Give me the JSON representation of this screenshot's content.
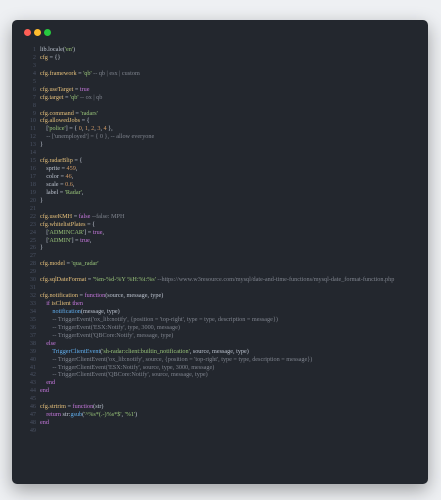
{
  "window": {
    "controls": [
      {
        "name": "close",
        "color": "#ff5f56"
      },
      {
        "name": "minimize",
        "color": "#ffbd2e"
      },
      {
        "name": "maximize",
        "color": "#27c93f"
      }
    ]
  },
  "colors": {
    "plain": "#bcc3cf",
    "keyword": "#c678dd",
    "function": "#61afef",
    "identifier": "#e6c07b",
    "string": "#98c379",
    "number": "#d19a66",
    "comment": "#7f848e"
  },
  "code_lines": [
    {
      "n": "1",
      "tokens": [
        [
          "lib.locale(",
          "plain"
        ],
        [
          "'en'",
          "str"
        ],
        [
          ")",
          "plain"
        ]
      ]
    },
    {
      "n": "2",
      "tokens": [
        [
          "cfg",
          "id"
        ],
        [
          " = {}",
          "plain"
        ]
      ]
    },
    {
      "n": "3",
      "tokens": []
    },
    {
      "n": "4",
      "tokens": [
        [
          "cfg.framework",
          "id"
        ],
        [
          " = ",
          "plain"
        ],
        [
          "'qb'",
          "str"
        ],
        [
          " -- qb | esx | custom",
          "cm"
        ]
      ]
    },
    {
      "n": "5",
      "tokens": []
    },
    {
      "n": "6",
      "tokens": [
        [
          "cfg.useTarget",
          "id"
        ],
        [
          " = ",
          "plain"
        ],
        [
          "true",
          "kw"
        ]
      ]
    },
    {
      "n": "7",
      "tokens": [
        [
          "cfg.target",
          "id"
        ],
        [
          " = ",
          "plain"
        ],
        [
          "'qb'",
          "str"
        ],
        [
          " -- ox | qb",
          "cm"
        ]
      ]
    },
    {
      "n": "8",
      "tokens": []
    },
    {
      "n": "9",
      "tokens": [
        [
          "cfg.command",
          "id"
        ],
        [
          " = ",
          "plain"
        ],
        [
          "'radars'",
          "str"
        ]
      ]
    },
    {
      "n": "10",
      "tokens": [
        [
          "cfg.allowedJobs",
          "id"
        ],
        [
          " = {",
          "plain"
        ]
      ]
    },
    {
      "n": "11",
      "tokens": [
        [
          "    [",
          "plain"
        ],
        [
          "'police'",
          "str"
        ],
        [
          "] = { ",
          "plain"
        ],
        [
          "0",
          "num"
        ],
        [
          ", ",
          "plain"
        ],
        [
          "1",
          "num"
        ],
        [
          ", ",
          "plain"
        ],
        [
          "2",
          "num"
        ],
        [
          ", ",
          "plain"
        ],
        [
          "3",
          "num"
        ],
        [
          ", ",
          "plain"
        ],
        [
          "4",
          "num"
        ],
        [
          " },",
          "plain"
        ]
      ]
    },
    {
      "n": "12",
      "tokens": [
        [
          "    -- ['unemployed'] = { 0 }, -- allow everyone",
          "cm"
        ]
      ]
    },
    {
      "n": "13",
      "tokens": [
        [
          "}",
          "plain"
        ]
      ]
    },
    {
      "n": "14",
      "tokens": []
    },
    {
      "n": "15",
      "tokens": [
        [
          "cfg.radarBlip",
          "id"
        ],
        [
          " = {",
          "plain"
        ]
      ]
    },
    {
      "n": "16",
      "tokens": [
        [
          "    sprite = ",
          "plain"
        ],
        [
          "459",
          "num"
        ],
        [
          ",",
          "plain"
        ]
      ]
    },
    {
      "n": "17",
      "tokens": [
        [
          "    color = ",
          "plain"
        ],
        [
          "46",
          "num"
        ],
        [
          ",",
          "plain"
        ]
      ]
    },
    {
      "n": "18",
      "tokens": [
        [
          "    scale = ",
          "plain"
        ],
        [
          "0.6",
          "num"
        ],
        [
          ",",
          "plain"
        ]
      ]
    },
    {
      "n": "19",
      "tokens": [
        [
          "    label = ",
          "plain"
        ],
        [
          "'Radar'",
          "str"
        ],
        [
          ",",
          "plain"
        ]
      ]
    },
    {
      "n": "20",
      "tokens": [
        [
          "}",
          "plain"
        ]
      ]
    },
    {
      "n": "21",
      "tokens": []
    },
    {
      "n": "22",
      "tokens": [
        [
          "cfg.useKMH",
          "id"
        ],
        [
          " = ",
          "plain"
        ],
        [
          "false",
          "kw"
        ],
        [
          " --false: MPH",
          "cm"
        ]
      ]
    },
    {
      "n": "23",
      "tokens": [
        [
          "cfg.whitelistPlates",
          "id"
        ],
        [
          " = {",
          "plain"
        ]
      ]
    },
    {
      "n": "24",
      "tokens": [
        [
          "    [",
          "plain"
        ],
        [
          "'ADMINCAR'",
          "str"
        ],
        [
          "] = ",
          "plain"
        ],
        [
          "true",
          "kw"
        ],
        [
          ",",
          "plain"
        ]
      ]
    },
    {
      "n": "25",
      "tokens": [
        [
          "    [",
          "plain"
        ],
        [
          "'ADMIN'",
          "str"
        ],
        [
          "] = ",
          "plain"
        ],
        [
          "true",
          "kw"
        ],
        [
          ",",
          "plain"
        ]
      ]
    },
    {
      "n": "26",
      "tokens": [
        [
          "}",
          "plain"
        ]
      ]
    },
    {
      "n": "27",
      "tokens": []
    },
    {
      "n": "28",
      "tokens": [
        [
          "cfg.model",
          "id"
        ],
        [
          " = ",
          "plain"
        ],
        [
          "'qua_radar'",
          "str"
        ]
      ]
    },
    {
      "n": "29",
      "tokens": []
    },
    {
      "n": "30",
      "tokens": [
        [
          "cfg.sqlDateFormat",
          "id"
        ],
        [
          " = ",
          "plain"
        ],
        [
          "'%m-%d-%Y %H:%i:%s'",
          "str"
        ],
        [
          " --https://www.w3resource.com/mysql/date-and-time-functions/mysql-date_format-function.php",
          "cm"
        ]
      ]
    },
    {
      "n": "31",
      "tokens": []
    },
    {
      "n": "32",
      "tokens": [
        [
          "cfg.notification",
          "id"
        ],
        [
          " = ",
          "plain"
        ],
        [
          "function",
          "kw"
        ],
        [
          "(source, message, type)",
          "plain"
        ]
      ]
    },
    {
      "n": "33",
      "tokens": [
        [
          "    ",
          "plain"
        ],
        [
          "if",
          "kw"
        ],
        [
          " ",
          "plain"
        ],
        [
          "isClient",
          "id"
        ],
        [
          " ",
          "plain"
        ],
        [
          "then",
          "kw"
        ]
      ]
    },
    {
      "n": "34",
      "tokens": [
        [
          "        ",
          "plain"
        ],
        [
          "notification",
          "fn"
        ],
        [
          "(message, type)",
          "plain"
        ]
      ]
    },
    {
      "n": "35",
      "tokens": [
        [
          "        -- TriggerEvent('ox_lib:notify', {position = 'top-right', type = type, description = message})",
          "cm"
        ]
      ]
    },
    {
      "n": "36",
      "tokens": [
        [
          "        -- TriggerEvent('ESX:Notify', type, 3000, message)",
          "cm"
        ]
      ]
    },
    {
      "n": "37",
      "tokens": [
        [
          "        -- TriggerEvent('QBCore:Notify', message, type)",
          "cm"
        ]
      ]
    },
    {
      "n": "38",
      "tokens": [
        [
          "    ",
          "plain"
        ],
        [
          "else",
          "kw"
        ]
      ]
    },
    {
      "n": "39",
      "tokens": [
        [
          "        ",
          "plain"
        ],
        [
          "TriggerClientEvent",
          "fn"
        ],
        [
          "(",
          "plain"
        ],
        [
          "'sh-radar:client:builtin_notification'",
          "str"
        ],
        [
          ", source, message, type)",
          "plain"
        ]
      ]
    },
    {
      "n": "40",
      "tokens": [
        [
          "        -- TriggerClientEvent('ox_lib:notify', source, {position = 'top-right', type = type, description = message})",
          "cm"
        ]
      ]
    },
    {
      "n": "41",
      "tokens": [
        [
          "        -- TriggerClientEvent('ESX:Notify', source, type, 3000, message)",
          "cm"
        ]
      ]
    },
    {
      "n": "42",
      "tokens": [
        [
          "        -- TriggerClientEvent('QBCore:Notify', source, message, type)",
          "cm"
        ]
      ]
    },
    {
      "n": "43",
      "tokens": [
        [
          "    ",
          "plain"
        ],
        [
          "end",
          "kw"
        ]
      ]
    },
    {
      "n": "44",
      "tokens": [
        [
          "end",
          "kw"
        ]
      ]
    },
    {
      "n": "45",
      "tokens": []
    },
    {
      "n": "46",
      "tokens": [
        [
          "cfg.strtrim",
          "id"
        ],
        [
          " = ",
          "plain"
        ],
        [
          "function",
          "kw"
        ],
        [
          "(str)",
          "plain"
        ]
      ]
    },
    {
      "n": "47",
      "tokens": [
        [
          "    ",
          "plain"
        ],
        [
          "return",
          "kw"
        ],
        [
          " str:",
          "plain"
        ],
        [
          "gsub",
          "fn"
        ],
        [
          "(",
          "plain"
        ],
        [
          "'^%s*(.-)%s*$'",
          "str"
        ],
        [
          ", ",
          "plain"
        ],
        [
          "'%1'",
          "str"
        ],
        [
          ")",
          "plain"
        ]
      ]
    },
    {
      "n": "48",
      "tokens": [
        [
          "end",
          "kw"
        ]
      ]
    },
    {
      "n": "49",
      "tokens": []
    }
  ]
}
